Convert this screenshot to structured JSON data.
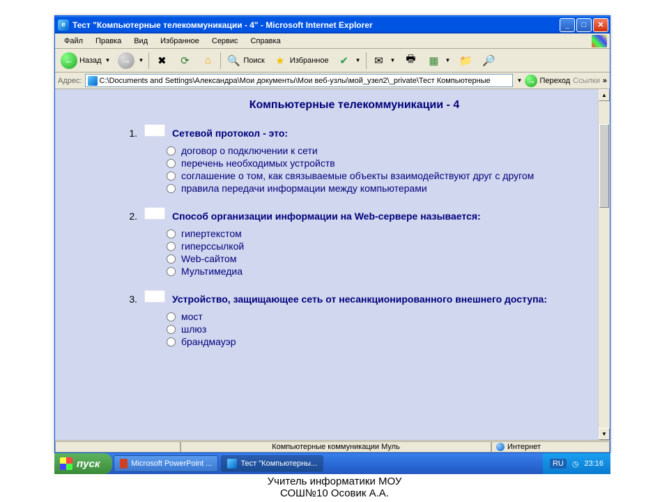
{
  "window": {
    "title": "Тест \"Компьютерные телекоммуникации - 4\" - Microsoft Internet Explorer"
  },
  "menu": {
    "items": [
      "Файл",
      "Правка",
      "Вид",
      "Избранное",
      "Сервис",
      "Справка"
    ]
  },
  "toolbar": {
    "back": "Назад",
    "search": "Поиск",
    "favorites": "Избранное"
  },
  "address": {
    "label": "Адрес:",
    "value": "C:\\Documents and Settings\\Александра\\Мои документы\\Мои веб-узлы\\мой_узел2\\_private\\Тест Компьютерные",
    "go": "Переход",
    "links": "Ссылки"
  },
  "page": {
    "title": "Компьютерные телекоммуникации - 4",
    "questions": [
      {
        "num": "1.",
        "text": "Сетевой протокол - это:",
        "options": [
          "договор о подключении к сети",
          "перечень необходимых устройств",
          "соглашение о том, как связываемые объекты взаимодействуют друг с другом",
          "правила передачи информации между компьютерами"
        ]
      },
      {
        "num": "2.",
        "text": "Способ организации информации на  Web-сервере называется:",
        "options": [
          "гипертекстом",
          "гиперссылкой",
          "Web-сайтом",
          "Мультимедиа"
        ]
      },
      {
        "num": "3.",
        "text": "Устройство, защищающее сеть от несанкционированного внешнего доступа:",
        "options": [
          "мост",
          "шлюз",
          "брандмауэр"
        ]
      }
    ]
  },
  "status": {
    "center": "Компьютерные коммуникации Муль",
    "right": "Интернет"
  },
  "taskbar": {
    "start": "пуск",
    "btn1": "Microsoft PowerPoint ...",
    "btn2": "Тест \"Компьютерны...",
    "lang": "RU",
    "time": "23:16"
  },
  "caption": {
    "line1": "Учитель информатики МОУ",
    "line2": "СОШ№10 Осовик А.А."
  }
}
